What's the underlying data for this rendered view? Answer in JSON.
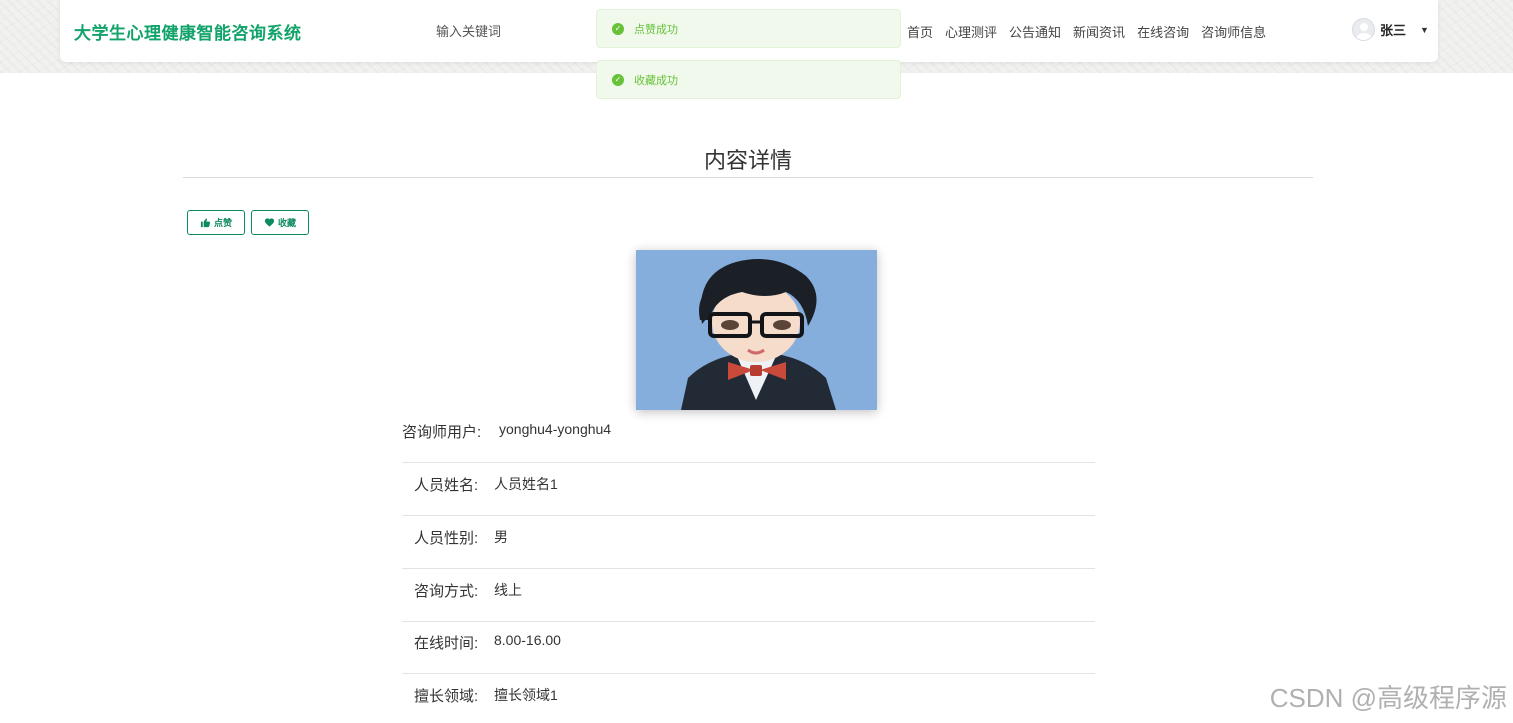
{
  "header": {
    "brand": "大学生心理健康智能咨询系统",
    "search_placeholder": "输入关键词",
    "nav": [
      "首页",
      "心理测评",
      "公告通知",
      "新闻资讯",
      "在线咨询",
      "咨询师信息"
    ],
    "username": "张三",
    "caret_icon": "caret-down-icon",
    "brand_color": "#12a36a"
  },
  "toasts": [
    {
      "text": "点赞成功",
      "icon": "success-check-icon"
    },
    {
      "text": "收藏成功",
      "icon": "success-check-icon"
    }
  ],
  "page": {
    "title": "内容详情",
    "like_label": "点赞",
    "favorite_label": "收藏",
    "accent_color": "#0e8a5f"
  },
  "details": [
    {
      "label": "咨询师用户:",
      "value": "yonghu4-yonghu4"
    },
    {
      "label": "人员姓名:",
      "value": "人员姓名1"
    },
    {
      "label": "人员性别:",
      "value": "男"
    },
    {
      "label": "咨询方式:",
      "value": "线上"
    },
    {
      "label": "在线时间:",
      "value": "8.00-16.00"
    },
    {
      "label": "擅长领域:",
      "value": "擅长领域1"
    }
  ],
  "watermark": "CSDN @高级程序源"
}
